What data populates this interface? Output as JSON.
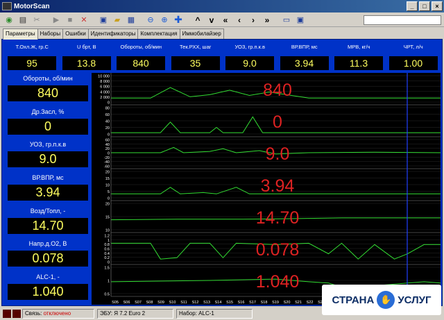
{
  "window": {
    "title": "MotorScan"
  },
  "toolbar": {
    "nav_glyphs": [
      "^",
      "v",
      "«",
      "‹",
      "›",
      "»"
    ]
  },
  "tabs": [
    {
      "label": "Параметры",
      "active": true
    },
    {
      "label": "Наборы",
      "active": false
    },
    {
      "label": "Ошибки",
      "active": false
    },
    {
      "label": "Идентификаторы",
      "active": false
    },
    {
      "label": "Комплектация",
      "active": false
    },
    {
      "label": "Иммобилайзер",
      "active": false
    }
  ],
  "params": [
    {
      "label": "Т.Охл.Ж, гр.С",
      "value": "95"
    },
    {
      "label": "U брт, В",
      "value": "13.8"
    },
    {
      "label": "Обороты, об/мин",
      "value": "840"
    },
    {
      "label": "Тек.РХХ, шаг",
      "value": "35"
    },
    {
      "label": "УОЗ, гр.п.к.в",
      "value": "9.0"
    },
    {
      "label": "ВР.ВПР, мс",
      "value": "3.94"
    },
    {
      "label": "МРВ, кг/ч",
      "value": "11.3"
    },
    {
      "label": "ЧРТ, л/ч",
      "value": "1.00"
    }
  ],
  "channels": [
    {
      "label": "Обороты, об/мин",
      "value": "840",
      "chart_value": "840",
      "ticks": [
        "10 000",
        "8 000",
        "6 000",
        "4 000",
        "2 000",
        "0"
      ]
    },
    {
      "label": "Др.Засл, %",
      "value": "0",
      "chart_value": "0",
      "ticks": [
        "80",
        "60",
        "40",
        "20",
        "0"
      ]
    },
    {
      "label": "УОЗ, гр.п.к.в",
      "value": "9.0",
      "chart_value": "9.0",
      "ticks": [
        "60",
        "40",
        "20",
        "0",
        "-20",
        "-40",
        "-60"
      ]
    },
    {
      "label": "ВР.ВПР, мс",
      "value": "3.94",
      "chart_value": "3.94",
      "ticks": [
        "20",
        "15",
        "10",
        "5",
        "0"
      ]
    },
    {
      "label": "Возд/Топл, -",
      "value": "14.70",
      "chart_value": "14.70",
      "ticks": [
        "20",
        "15",
        "10"
      ]
    },
    {
      "label": "Напр.д.О2, В",
      "value": "0.078",
      "chart_value": "0.078",
      "ticks": [
        "1.2",
        "1",
        "0.8",
        "0.6",
        "0.4",
        "0.2",
        "0"
      ]
    },
    {
      "label": "ALC-1, -",
      "value": "1.040",
      "chart_value": "1.040",
      "ticks": [
        "1.5",
        "1",
        "0.5"
      ]
    }
  ],
  "time_axis": [
    "S05",
    "S06",
    "S07",
    "S08",
    "S09",
    "S10",
    "S11",
    "S12",
    "S13",
    "S14",
    "S15",
    "S16",
    "S17",
    "S18",
    "S19",
    "S20",
    "S21",
    "S22",
    "S23"
  ],
  "status": {
    "link_label": "Связь:",
    "link_value": "отключено",
    "ecu_label": "ЭБУ:",
    "ecu_value": "Я 7.2 Euro 2",
    "set_label": "Набор:",
    "set_value": "ALC-1"
  },
  "watermark": {
    "left": "СТРАНА",
    "right": "УСЛУГ"
  },
  "colors": {
    "panel": "#0032c8",
    "value_text": "#ffff60",
    "trace": "#33dd33",
    "overlay_value": "#dd2222",
    "cursor": "#2040ff"
  }
}
